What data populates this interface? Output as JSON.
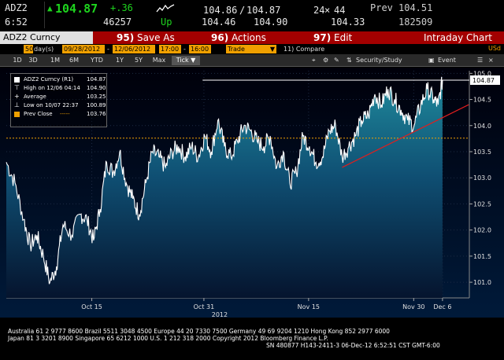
{
  "quote": {
    "ticker": "ADZ2",
    "time": "6:52",
    "last": "104.87",
    "change": "+.36",
    "volume": "46257",
    "up_label": "Up",
    "bid": "104.86",
    "ask": "104.87",
    "bid_size": "24",
    "ask_size": "44",
    "open": "104.46",
    "high": "104.90",
    "low": "104.33",
    "prev_label": "Prev",
    "prev": "104.51",
    "open_interest": "182509"
  },
  "menu": {
    "security": "ADZ2 Curncy",
    "save_num": "95)",
    "save_label": "Save As",
    "actions_num": "96)",
    "actions_label": "Actions",
    "edit_num": "97)",
    "edit_label": "Edit",
    "chart_type": "Intraday Chart"
  },
  "params": {
    "days": "50",
    "days_unit": "day(s)",
    "start_date": "09/28/2012",
    "end_date": "12/06/2012",
    "start_time": "17:00",
    "end_time": "16:00",
    "event_type": "Trade",
    "compare_label": "11) Compare",
    "currency": "USd"
  },
  "tabs": {
    "items": [
      "1D",
      "3D",
      "1M",
      "6M",
      "YTD",
      "1Y",
      "5Y",
      "Max"
    ],
    "active": "Tick ▼",
    "security_study": "Security/Study",
    "event": "Event"
  },
  "legend": {
    "title": "ADZ2 Curncy  (R1)",
    "title_value": "104.87",
    "high_label": "High on 12/06 04:14",
    "high_value": "104.90",
    "avg_label": "Average",
    "avg_value": "103.25",
    "low_label": "Low on 10/07 22:37",
    "low_value": "100.89",
    "prev_label": "Prev Close",
    "prev_value": "103.76"
  },
  "colors": {
    "up": "#1ed41e",
    "menu_bg": "#a30000",
    "param_bg": "#f0a000",
    "prev_close_line": "#f0a000",
    "trend_line": "#e01e1e",
    "price_line": "#ffffff"
  },
  "chart_data": {
    "type": "line",
    "xlabel": "2012",
    "ylabel": "",
    "ylim": [
      100.7,
      105.05
    ],
    "y_ticks": [
      101.0,
      101.5,
      102.0,
      102.5,
      103.0,
      103.5,
      104.0,
      104.5,
      105.0
    ],
    "y_tick_labels": [
      "101.0",
      "101.5",
      "102.0",
      "102.5",
      "103.0",
      "103.5",
      "104.0",
      "104.5",
      "105.0"
    ],
    "x_ticks": [
      {
        "label": "Oct 15",
        "at": 0.196
      },
      {
        "label": "Oct 31",
        "at": 0.453
      },
      {
        "label": "Nov 15",
        "at": 0.693
      },
      {
        "label": "Nov 30",
        "at": 0.934
      },
      {
        "label": "Dec 6",
        "at": 1.0
      }
    ],
    "current_value": 104.87,
    "prev_close": 103.76,
    "high_line": 104.87,
    "trend_line": {
      "from": [
        0.77,
        103.2
      ],
      "to": [
        1.06,
        104.4
      ]
    },
    "series": [
      {
        "x": [
          0.0,
          0.02,
          0.04,
          0.055,
          0.07,
          0.085,
          0.1,
          0.115,
          0.13,
          0.15,
          0.17,
          0.185,
          0.2,
          0.215,
          0.23,
          0.245,
          0.26,
          0.275,
          0.29,
          0.305,
          0.32,
          0.335,
          0.35,
          0.365,
          0.38,
          0.395,
          0.41,
          0.425,
          0.44,
          0.455,
          0.47,
          0.485,
          0.5,
          0.515,
          0.53,
          0.545,
          0.56,
          0.575,
          0.59,
          0.605,
          0.62,
          0.635,
          0.65,
          0.665,
          0.68,
          0.695,
          0.71,
          0.725,
          0.74,
          0.755,
          0.77,
          0.785,
          0.8,
          0.815,
          0.83,
          0.845,
          0.86,
          0.875,
          0.89,
          0.905,
          0.92,
          0.935,
          0.95,
          0.965,
          0.98,
          0.99,
          1.0
        ],
        "y": [
          103.3,
          102.9,
          102.2,
          101.7,
          101.9,
          101.5,
          101.0,
          101.3,
          102.1,
          101.9,
          102.3,
          102.2,
          101.8,
          102.4,
          103.3,
          103.1,
          103.5,
          102.9,
          102.6,
          102.3,
          102.9,
          103.5,
          103.4,
          103.2,
          103.5,
          103.6,
          103.4,
          103.6,
          103.4,
          103.8,
          103.5,
          104.1,
          103.6,
          103.4,
          103.7,
          104.0,
          103.9,
          103.7,
          103.6,
          103.8,
          103.2,
          103.5,
          102.9,
          103.1,
          103.8,
          103.6,
          103.3,
          103.4,
          103.9,
          104.0,
          103.4,
          103.6,
          103.8,
          104.1,
          104.2,
          104.6,
          104.4,
          104.7,
          104.5,
          104.3,
          104.1,
          104.0,
          104.4,
          104.7,
          104.5,
          104.4,
          104.87
        ]
      }
    ]
  },
  "footer": {
    "line1": "Australia 61 2 9777 8600 Brazil 5511 3048 4500 Europe 44 20 7330 7500 Germany 49 69 9204 1210 Hong Kong 852 2977 6000",
    "line2": "Japan 81 3 3201 8900         Singapore 65 6212 1000          U.S. 1 212 318 2000         Copyright 2012 Bloomberg Finance L.P.",
    "line3": "SN 480877 H143-2411-3 06-Dec-12  6:52:51 CST  GMT-6:00"
  }
}
